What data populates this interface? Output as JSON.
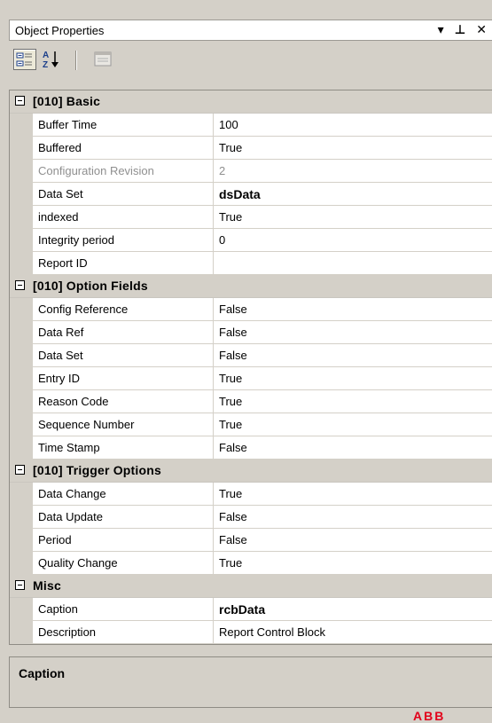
{
  "panel": {
    "title": "Object Properties",
    "title_buttons": "▾ ⊥ ✕"
  },
  "categories": [
    {
      "label": "[010] Basic",
      "properties": [
        {
          "name": "Buffer Time",
          "value": "100"
        },
        {
          "name": "Buffered",
          "value": "True"
        },
        {
          "name": "Configuration Revision",
          "value": "2",
          "disabled": true
        },
        {
          "name": "Data Set",
          "value": "dsData",
          "bold": true
        },
        {
          "name": "indexed",
          "value": "True"
        },
        {
          "name": "Integrity period",
          "value": "0"
        },
        {
          "name": "Report ID",
          "value": ""
        }
      ]
    },
    {
      "label": "[010] Option Fields",
      "properties": [
        {
          "name": "Config Reference",
          "value": "False"
        },
        {
          "name": "Data Ref",
          "value": "False"
        },
        {
          "name": "Data Set",
          "value": "False"
        },
        {
          "name": "Entry ID",
          "value": "True"
        },
        {
          "name": "Reason Code",
          "value": "True"
        },
        {
          "name": "Sequence Number",
          "value": "True"
        },
        {
          "name": "Time Stamp",
          "value": "False"
        }
      ]
    },
    {
      "label": "[010] Trigger Options",
      "properties": [
        {
          "name": "Data Change",
          "value": "True"
        },
        {
          "name": "Data Update",
          "value": "False"
        },
        {
          "name": "Period",
          "value": "False"
        },
        {
          "name": "Quality Change",
          "value": "True"
        }
      ]
    },
    {
      "label": "Misc",
      "properties": [
        {
          "name": "Caption",
          "value": "rcbData",
          "bold": true
        },
        {
          "name": "Description",
          "value": "Report Control Block"
        }
      ]
    }
  ],
  "description_pane": {
    "title": "Caption"
  },
  "footer_logo": "ABB",
  "colors": {
    "panel_bg": "#d4d0c8",
    "grid_bg": "#ffffff",
    "disabled_text": "#8f8f8f",
    "logo": "#e2001a"
  }
}
